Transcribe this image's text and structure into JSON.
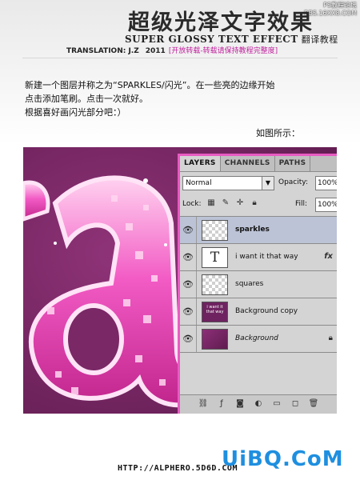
{
  "watermark_top": {
    "line1": "PS教程论坛",
    "line2": "BBS.16XX8.COM"
  },
  "header": {
    "title_cn": "超级光泽文字效果",
    "title_en": "SUPER GLOSSY TEXT EFFECT",
    "title_en_cn": "翻译教程",
    "credit": "TRANSLATION: J.Z",
    "year": "2011",
    "note": "[开放转载-转载请保持教程完整度]"
  },
  "instructions": {
    "line1": "新建一个图层并称之为“SPARKLES/闪光”。在一些亮的边缘开始",
    "line2": "点击添加笔刷。点击一次就好。",
    "line3": "根据喜好画闪光部分吧：）",
    "caption": "如图所示："
  },
  "panel": {
    "tabs": [
      "LAYERS",
      "CHANNELS",
      "PATHS"
    ],
    "blend_mode": "Normal",
    "opacity_label": "Opacity:",
    "opacity_value": "100%",
    "lock_label": "Lock:",
    "fill_label": "Fill:",
    "fill_value": "100%",
    "layers": [
      {
        "name": "sparkles",
        "thumb": "checker",
        "selected": true
      },
      {
        "name": "i want it that way",
        "thumb": "text",
        "thumb_glyph": "T",
        "fx": "fx"
      },
      {
        "name": "squares",
        "thumb": "checker"
      },
      {
        "name": "Background copy",
        "thumb": "copy",
        "thumb_text": "i want it that way"
      },
      {
        "name": "Background",
        "thumb": "background",
        "locked": true
      }
    ]
  },
  "footer": {
    "url": "HTTP://ALPHERO.5D6D.COM",
    "logo": "UiBQ.CoM"
  },
  "colors": {
    "accent_pink": "#e85bc2",
    "note_magenta": "#c0229e",
    "logo_blue": "#1e8fe0",
    "canvas_purple": "#7a2866"
  }
}
